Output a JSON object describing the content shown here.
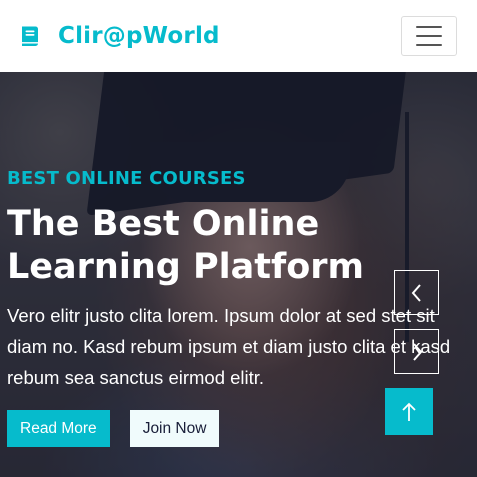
{
  "navbar": {
    "brand": "Clir@pWorld",
    "brand_icon": "book-icon",
    "toggler_icon": "hamburger-menu-icon",
    "accent_color": "#06BBCC"
  },
  "hero": {
    "subtitle": "BEST ONLINE COURSES",
    "title_line1": "The Best Online",
    "title_line2": "Learning Platform",
    "text": "Vero elitr justo clita lorem. Ipsum dolor at sed stet sit diam no. Kasd rebum ipsum et diam justo clita et kasd rebum sea sanctus eirmod elitr.",
    "read_more_label": "Read More",
    "join_now_label": "Join Now",
    "background_image": "graduate-with-cap-photo"
  },
  "carousel": {
    "prev_icon": "chevron-left-icon",
    "next_icon": "chevron-right-icon"
  },
  "back_to_top": {
    "icon": "arrow-up-icon"
  }
}
